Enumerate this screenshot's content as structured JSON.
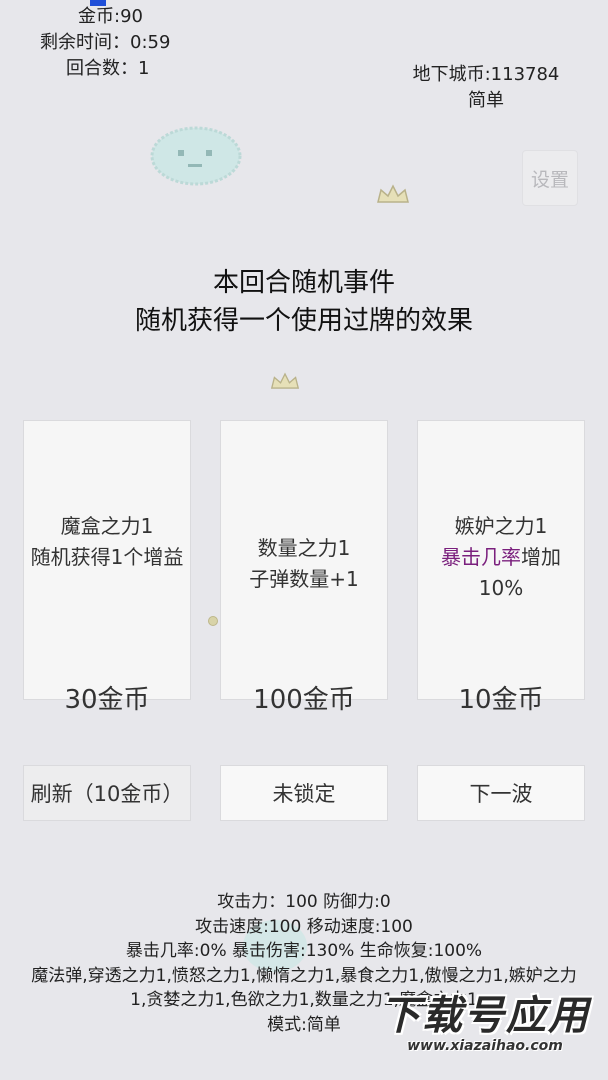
{
  "hud": {
    "gold": "金币:90",
    "time_left": "剩余时间：0:59",
    "round": "回合数：1",
    "dungeon_coins": "地下城币:113784",
    "difficulty": "简单",
    "settings_label": "设置"
  },
  "event": {
    "title": "本回合随机事件",
    "description": "随机获得一个使用过牌的效果"
  },
  "cards": [
    {
      "line1": "魔盒之力1",
      "line2": "随机获得1个增益",
      "price": "30金币"
    },
    {
      "line1": "数量之力1",
      "line2": "子弹数量+1",
      "price": "100金币"
    },
    {
      "line1": "嫉妒之力1",
      "highlight": "暴击几率",
      "line2_rest": "增加10%",
      "price": "10金币"
    }
  ],
  "buttons": {
    "refresh": "刷新（10金币）",
    "lock": "未锁定",
    "next_wave": "下一波"
  },
  "stats": {
    "line1": "攻击力：100 防御力:0",
    "line2": "攻击速度:100 移动速度:100",
    "line3": "暴击几率:0% 暴击伤害:130% 生命恢复:100%",
    "line4": "魔法弹,穿透之力1,愤怒之力1,懒惰之力1,暴食之力1,傲慢之力1,嫉妒之力1,贪婪之力1,色欲之力1,数量之力1,魔盒之力1",
    "line5": "模式:简单"
  },
  "watermark": {
    "title": "下载号应用",
    "url": "www.xiazaihao.com"
  },
  "colors": {
    "background": "#e7e7eb",
    "card": "#f6f6f6",
    "highlight": "#7a1f7d",
    "marker": "#1f4fd8"
  }
}
